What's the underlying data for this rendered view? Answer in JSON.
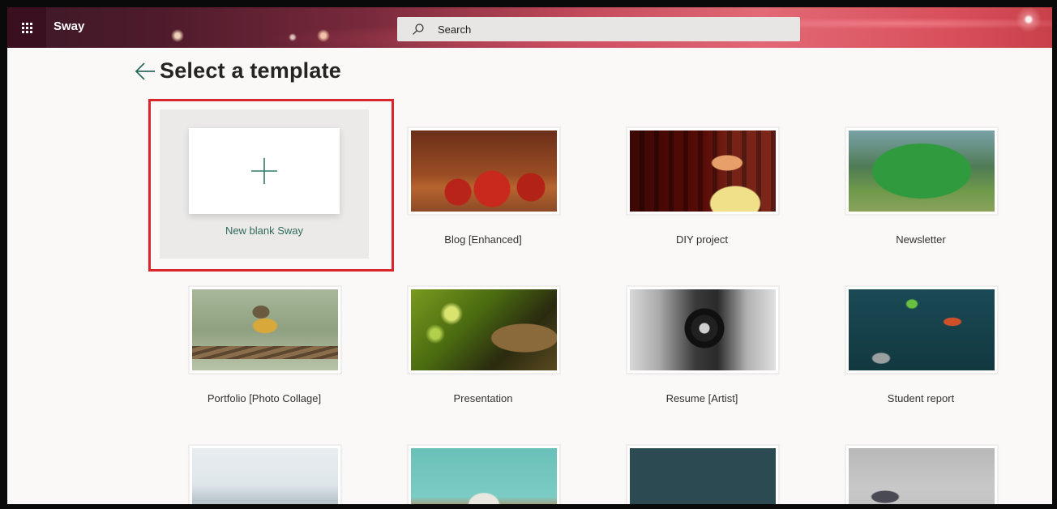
{
  "topbar": {
    "app_name": "Sway",
    "search_placeholder": "Search"
  },
  "page": {
    "title": "Select a template"
  },
  "new_blank": {
    "label": "New blank Sway"
  },
  "templates": [
    {
      "label": "Blog [Enhanced]"
    },
    {
      "label": "DIY project"
    },
    {
      "label": "Newsletter"
    },
    {
      "label": "Portfolio [Photo Collage]"
    },
    {
      "label": "Presentation"
    },
    {
      "label": "Resume [Artist]"
    },
    {
      "label": "Student report"
    }
  ],
  "colors": {
    "accent": "#2e7d6b",
    "highlight": "#d9262c",
    "background": "#faf9f8"
  }
}
